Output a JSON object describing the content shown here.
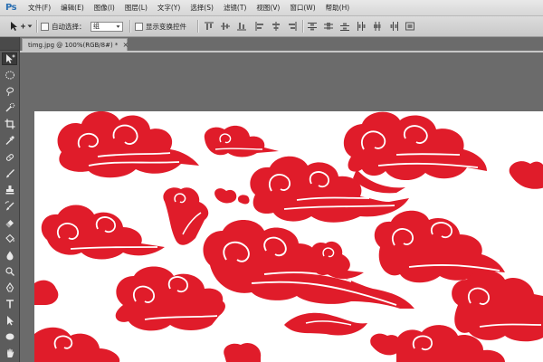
{
  "app": {
    "logo": "Ps"
  },
  "menu": {
    "items": [
      "文件(F)",
      "编辑(E)",
      "图像(I)",
      "图层(L)",
      "文字(Y)",
      "选择(S)",
      "滤镜(T)",
      "视图(V)",
      "窗口(W)",
      "帮助(H)"
    ]
  },
  "options_bar": {
    "move_tool_icon": "move-tool-icon",
    "auto_select_label": "自动选择：",
    "auto_select_checked": false,
    "auto_select_value": "组",
    "show_transform_label": "显示变换控件",
    "show_transform_checked": false
  },
  "document": {
    "tab_title": "timg.jpg @ 100%(RGB/8#) *",
    "tab_close": "×",
    "canvas_background": "#ffffff",
    "artwork_color": "#e01c2a"
  },
  "tools": [
    "move-tool",
    "marquee-tool",
    "lasso-tool",
    "quick-selection-tool",
    "crop-tool",
    "eyedropper-tool",
    "spot-healing-tool",
    "brush-tool",
    "clone-stamp-tool",
    "history-brush-tool",
    "eraser-tool",
    "gradient-tool",
    "blur-tool",
    "dodge-tool",
    "pen-tool",
    "type-tool",
    "path-selection-tool",
    "shape-tool",
    "hand-tool"
  ]
}
